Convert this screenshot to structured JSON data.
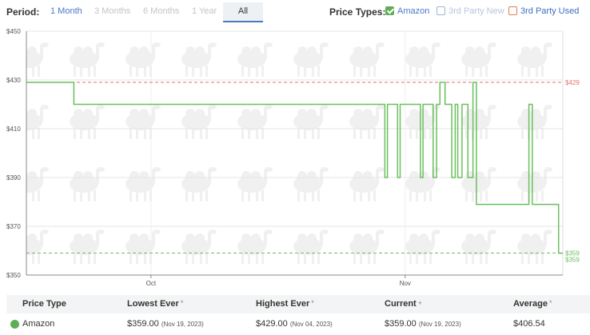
{
  "period": {
    "label": "Period:",
    "options": [
      "1 Month",
      "3 Months",
      "6 Months",
      "1 Year",
      "All"
    ],
    "selected": "All"
  },
  "price_types": {
    "label": "Price Types:",
    "items": [
      {
        "label": "Amazon",
        "checked": true,
        "color": "#4a78c8"
      },
      {
        "label": "3rd Party New",
        "checked": false,
        "color": "#b8c6dd"
      },
      {
        "label": "3rd Party Used",
        "checked": false,
        "color": "#3e6cc0"
      }
    ]
  },
  "chart_data": {
    "type": "line",
    "ylim": [
      350,
      450
    ],
    "y_ticks": [
      "$450",
      "$430",
      "$410",
      "$390",
      "$370",
      "$350"
    ],
    "x_ticks": [
      "Oct",
      "Nov"
    ],
    "reference_lines": [
      {
        "label": "$429",
        "value": 429,
        "color": "#e07070"
      },
      {
        "label": "$359",
        "value": 359,
        "color": "#6bbf5f"
      }
    ],
    "end_labels": [
      "$359",
      "$359"
    ],
    "series": [
      {
        "name": "Amazon",
        "color": "#6bbf5f",
        "step": true,
        "points": [
          [
            0,
            429
          ],
          [
            5.6,
            429
          ],
          [
            5.6,
            420
          ],
          [
            42.3,
            420
          ],
          [
            42.3,
            390
          ],
          [
            42.6,
            390
          ],
          [
            42.6,
            420
          ],
          [
            43.8,
            420
          ],
          [
            43.8,
            390
          ],
          [
            44.1,
            390
          ],
          [
            44.1,
            420
          ],
          [
            46.5,
            420
          ],
          [
            46.5,
            390
          ],
          [
            46.8,
            390
          ],
          [
            46.8,
            420
          ],
          [
            48.0,
            420
          ],
          [
            48.0,
            390
          ],
          [
            48.4,
            390
          ],
          [
            48.4,
            420
          ],
          [
            48.8,
            420
          ],
          [
            48.8,
            429
          ],
          [
            49.4,
            429
          ],
          [
            49.4,
            420
          ],
          [
            50.2,
            420
          ],
          [
            50.2,
            390
          ],
          [
            50.6,
            390
          ],
          [
            50.6,
            420
          ],
          [
            50.9,
            420
          ],
          [
            50.9,
            390
          ],
          [
            51.4,
            390
          ],
          [
            51.4,
            420
          ],
          [
            52.1,
            420
          ],
          [
            52.1,
            390
          ],
          [
            52.7,
            390
          ],
          [
            52.7,
            429
          ],
          [
            53.1,
            429
          ],
          [
            53.1,
            379
          ],
          [
            59.3,
            379
          ],
          [
            59.3,
            420
          ],
          [
            59.7,
            420
          ],
          [
            59.7,
            379
          ],
          [
            62.8,
            379
          ],
          [
            62.8,
            359
          ],
          [
            63.3,
            359
          ]
        ]
      }
    ]
  },
  "stats_table": {
    "headers": [
      {
        "label": "Price Type",
        "mark": ""
      },
      {
        "label": "Lowest Ever",
        "mark": "*"
      },
      {
        "label": "Highest Ever",
        "mark": "*"
      },
      {
        "label": "Current",
        "mark": "+"
      },
      {
        "label": "Average",
        "mark": "*"
      }
    ],
    "rows": [
      {
        "type": "Amazon",
        "lowest": "$359.00",
        "lowest_date": "(Nov 19, 2023)",
        "highest": "$429.00",
        "highest_date": "(Nov 04, 2023)",
        "current": "$359.00",
        "current_date": "(Nov 19, 2023)",
        "average": "$406.54"
      }
    ]
  }
}
